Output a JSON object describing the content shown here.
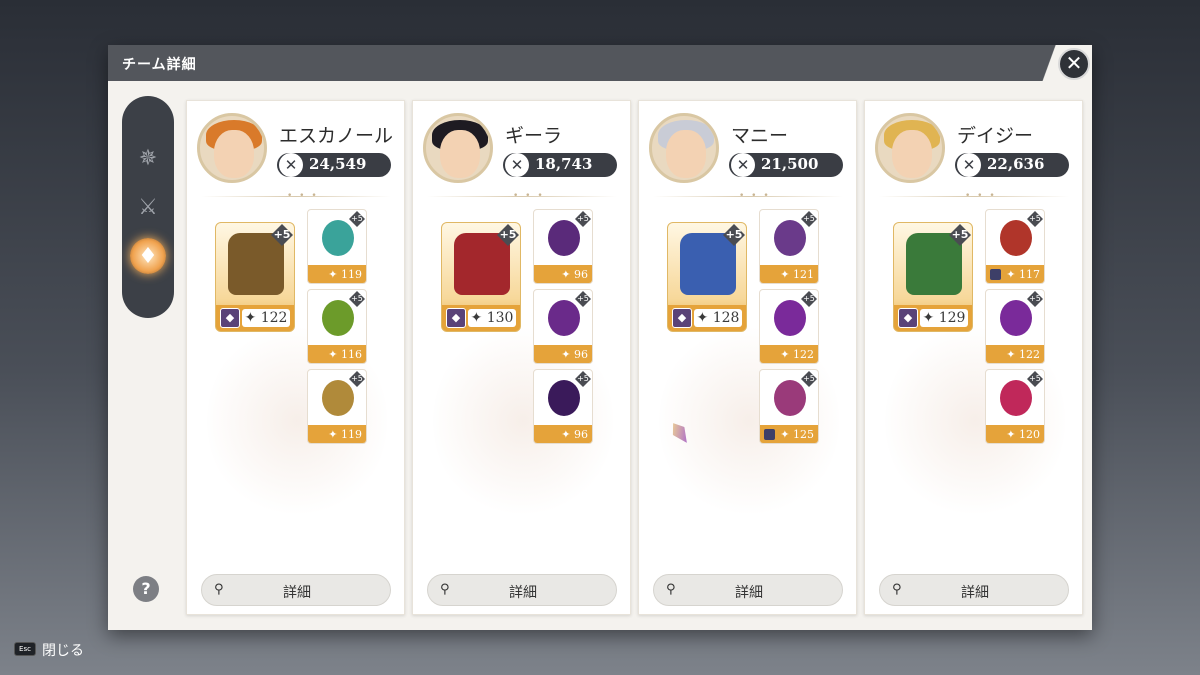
{
  "window": {
    "title": "チーム詳細",
    "close_icon": "close-icon"
  },
  "sidebar": {
    "items": [
      {
        "icon": "team-crest-icon",
        "active": false
      },
      {
        "icon": "weapons-icon",
        "active": false
      },
      {
        "icon": "armor-icon",
        "active": true
      }
    ],
    "help_label": "?"
  },
  "characters": [
    {
      "name": "エスカノール",
      "power": "24,549",
      "armor": {
        "plus": "+5",
        "level": "122",
        "emblem": "shield-emblem",
        "color": "#7a5a2a"
      },
      "accessories": [
        {
          "plus": "+5",
          "level": "119",
          "color": "#3aa39a"
        },
        {
          "plus": "+5",
          "level": "116",
          "color": "#6c9b2a"
        },
        {
          "plus": "+5",
          "level": "119",
          "color": "#b08a3a"
        }
      ],
      "detail_label": "詳細"
    },
    {
      "name": "ギーラ",
      "power": "18,743",
      "armor": {
        "plus": "+5",
        "level": "130",
        "emblem": "shield-emblem",
        "color": "#a3272c"
      },
      "accessories": [
        {
          "plus": "+5",
          "level": "96",
          "color": "#5a2a7a"
        },
        {
          "plus": "+5",
          "level": "96",
          "color": "#6a2a8a"
        },
        {
          "plus": "+5",
          "level": "96",
          "color": "#3a1a5a"
        }
      ],
      "detail_label": "詳細"
    },
    {
      "name": "マニー",
      "power": "21,500",
      "armor": {
        "plus": "+5",
        "level": "128",
        "emblem": "shield-emblem",
        "color": "#3a5fb0"
      },
      "accessories": [
        {
          "plus": "+5",
          "level": "121",
          "color": "#6a3a8a"
        },
        {
          "plus": "+5",
          "level": "122",
          "color": "#7a2a9a"
        },
        {
          "plus": "+5",
          "level": "125",
          "color": "#9a3a7a"
        }
      ],
      "detail_label": "詳細"
    },
    {
      "name": "デイジー",
      "power": "22,636",
      "armor": {
        "plus": "+5",
        "level": "129",
        "emblem": "shield-emblem",
        "color": "#3a7a3a"
      },
      "accessories": [
        {
          "plus": "+5",
          "level": "117",
          "color": "#b0352a"
        },
        {
          "plus": "+5",
          "level": "122",
          "color": "#7a2a9a"
        },
        {
          "plus": "+5",
          "level": "120",
          "color": "#c0285a"
        }
      ],
      "detail_label": "詳細"
    }
  ],
  "footer": {
    "key": "Esc",
    "label": "閉じる"
  }
}
